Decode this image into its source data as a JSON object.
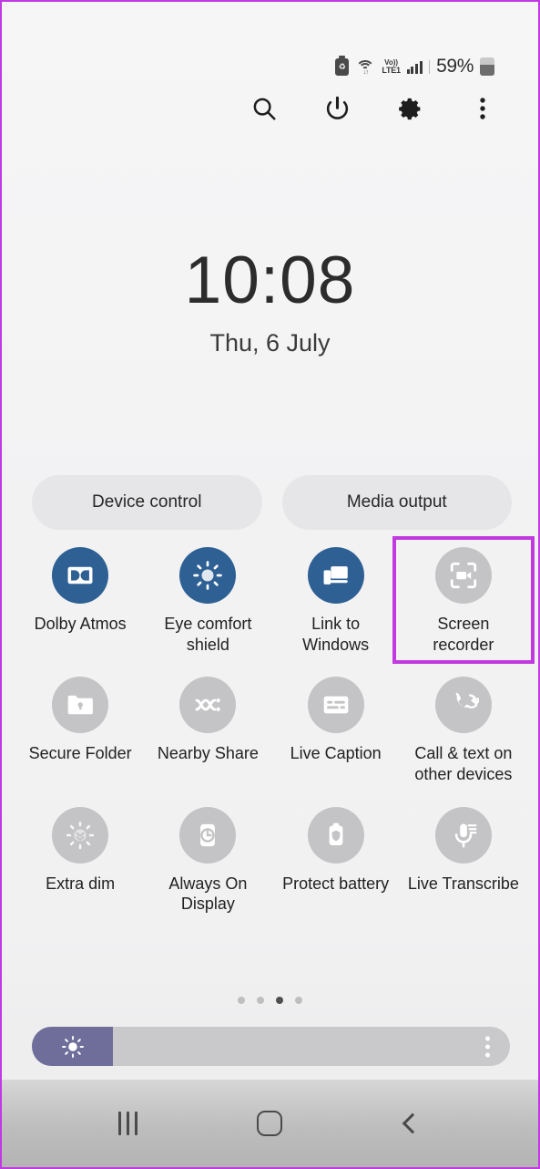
{
  "statusbar": {
    "battery_saver_icon": "recycle-battery-icon",
    "wifi_icon": "wifi-icon",
    "network_top": "Vo))",
    "network_bottom": "LTE1",
    "signal_icon": "signal-bars-icon",
    "battery_percent": "59%",
    "battery_level": 59,
    "battery_icon": "battery-icon"
  },
  "toolbar": {
    "search_label": "search-icon",
    "power_label": "power-icon",
    "settings_label": "settings-gear-icon",
    "more_label": "more-options-icon"
  },
  "clock": {
    "time": "10:08",
    "date": "Thu, 6 July"
  },
  "pills": [
    {
      "label": "Device control",
      "name": "device-control-button"
    },
    {
      "label": "Media output",
      "name": "media-output-button"
    }
  ],
  "tiles": [
    {
      "label": "Dolby Atmos",
      "name": "tile-dolby-atmos",
      "icon": "dolby-atmos-icon",
      "active": true,
      "highlighted": false
    },
    {
      "label": "Eye comfort shield",
      "name": "tile-eye-comfort-shield",
      "icon": "eye-comfort-shield-icon",
      "active": true,
      "highlighted": false
    },
    {
      "label": "Link to Windows",
      "name": "tile-link-to-windows",
      "icon": "link-to-windows-icon",
      "active": true,
      "highlighted": false
    },
    {
      "label": "Screen recorder",
      "name": "tile-screen-recorder",
      "icon": "screen-recorder-icon",
      "active": false,
      "highlighted": true
    },
    {
      "label": "Secure Folder",
      "name": "tile-secure-folder",
      "icon": "secure-folder-icon",
      "active": false,
      "highlighted": false
    },
    {
      "label": "Nearby Share",
      "name": "tile-nearby-share",
      "icon": "nearby-share-icon",
      "active": false,
      "highlighted": false
    },
    {
      "label": "Live Caption",
      "name": "tile-live-caption",
      "icon": "live-caption-icon",
      "active": false,
      "highlighted": false
    },
    {
      "label": "Call & text on other devices",
      "name": "tile-call-text-other-devices",
      "icon": "call-text-other-devices-icon",
      "active": false,
      "highlighted": false
    },
    {
      "label": "Extra dim",
      "name": "tile-extra-dim",
      "icon": "extra-dim-icon",
      "active": false,
      "highlighted": false
    },
    {
      "label": "Always On Display",
      "name": "tile-always-on-display",
      "icon": "always-on-display-icon",
      "active": false,
      "highlighted": false
    },
    {
      "label": "Protect battery",
      "name": "tile-protect-battery",
      "icon": "protect-battery-icon",
      "active": false,
      "highlighted": false
    },
    {
      "label": "Live Transcribe",
      "name": "tile-live-transcribe",
      "icon": "live-transcribe-icon",
      "active": false,
      "highlighted": false
    }
  ],
  "page_dots": {
    "count": 4,
    "active_index": 2
  },
  "brightness": {
    "value_percent": 17,
    "icon": "brightness-sun-icon",
    "menu_icon": "brightness-more-options-icon"
  },
  "navbar": {
    "recents_label": "recents-button",
    "home_label": "home-button",
    "back_label": "back-button"
  },
  "colors": {
    "accent_blue": "#2e6094",
    "tile_inactive": "#c4c4c6",
    "highlight": "#c13ae0",
    "slider_fill": "#6f6e9b",
    "background": "#f2f2f3"
  }
}
